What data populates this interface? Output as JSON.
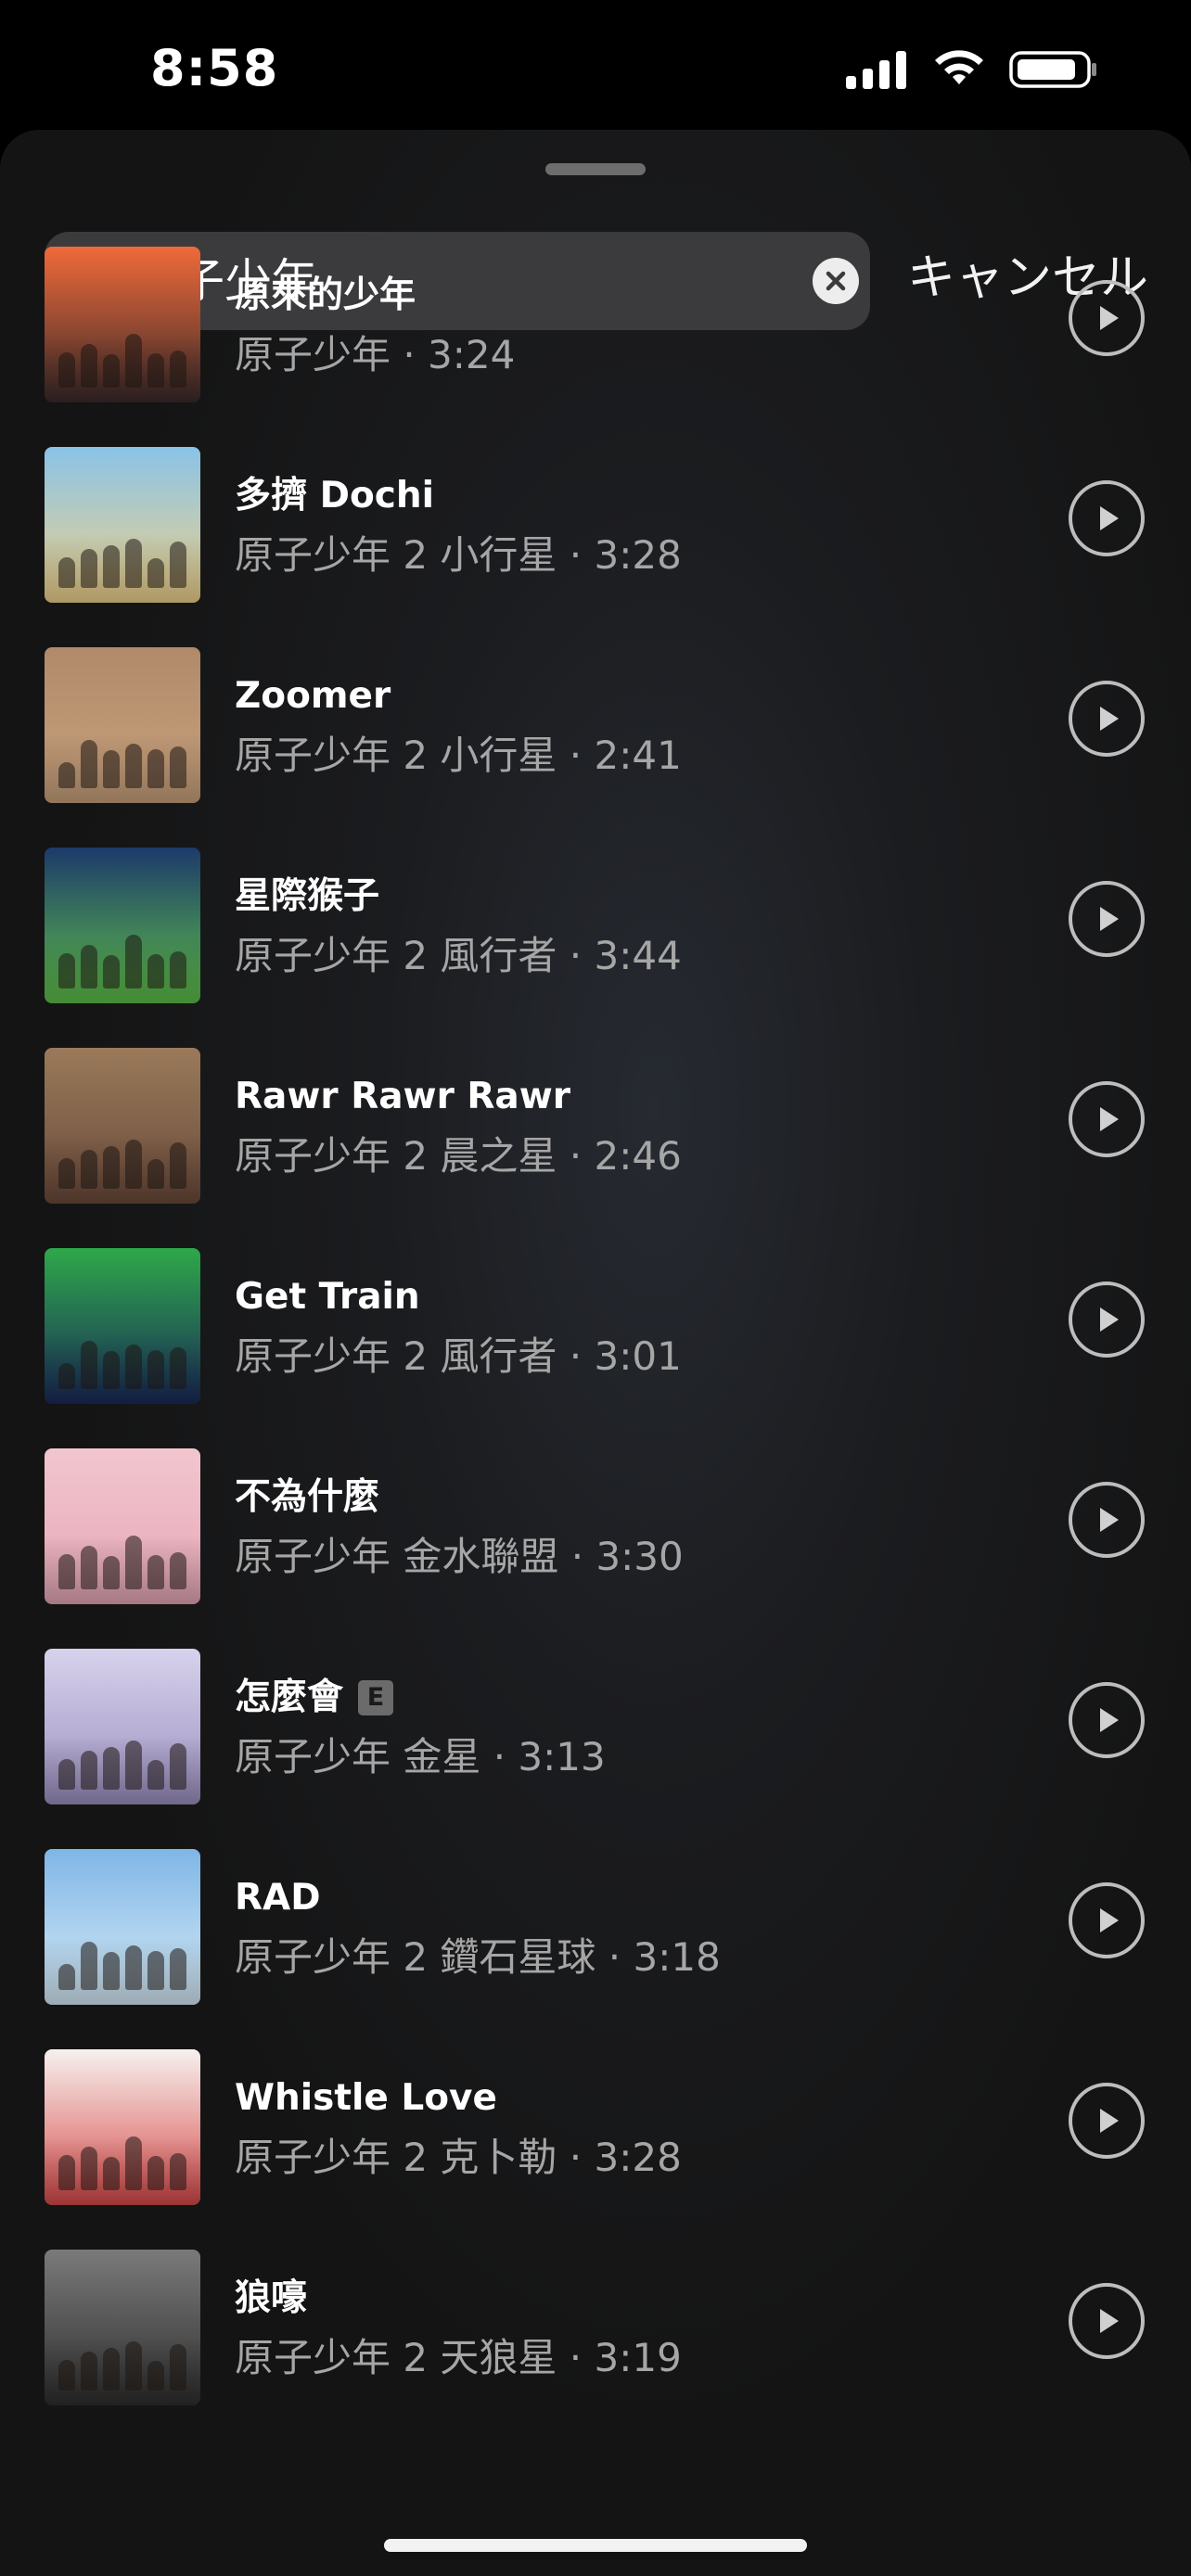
{
  "status_bar": {
    "time": "8:58",
    "icons": [
      "cellular-signal-icon",
      "wifi-icon",
      "battery-icon"
    ]
  },
  "search": {
    "query": "原子少年",
    "cancel_label": "キャンセル",
    "icons": [
      "search-icon",
      "clear-icon"
    ]
  },
  "colors": {
    "background": "#141414",
    "search_field": "#3b3b3d",
    "secondary_text": "#a6a6a6",
    "play_ring": "#bdbdbd"
  },
  "results": [
    {
      "title": "原來的少年",
      "meta": "原子少年 · 3:24",
      "explicit": false,
      "art_top": "#f06a3a",
      "art_bottom": "#3a2a2a"
    },
    {
      "title": "多擠 Dochi",
      "meta": "原子少年 2 小行星 · 3:28",
      "explicit": false,
      "art_top": "#8ac3e8",
      "art_bottom": "#f0d28a"
    },
    {
      "title": "Zoomer",
      "meta": "原子少年 2 小行星 · 2:41",
      "explicit": false,
      "art_top": "#b08a6a",
      "art_bottom": "#c9a27d"
    },
    {
      "title": "星際猴子",
      "meta": "原子少年 2 風行者 · 3:44",
      "explicit": false,
      "art_top": "#1c3a6a",
      "art_bottom": "#5fc04a"
    },
    {
      "title": "Rawr Rawr Rawr",
      "meta": "原子少年 2 晨之星 · 2:46",
      "explicit": false,
      "art_top": "#9a7a5a",
      "art_bottom": "#6a4a3a"
    },
    {
      "title": "Get Train",
      "meta": "原子少年 2 風行者 · 3:01",
      "explicit": false,
      "art_top": "#2ea84a",
      "art_bottom": "#1a2a5a"
    },
    {
      "title": "不為什麼",
      "meta": "原子少年 金水聯盟 · 3:30",
      "explicit": false,
      "art_top": "#f2c6cf",
      "art_bottom": "#e5a7b6"
    },
    {
      "title": "怎麼會",
      "meta": "原子少年 金星 · 3:13",
      "explicit": true,
      "explicit_label": "E",
      "art_top": "#d7d2ec",
      "art_bottom": "#9c90c0"
    },
    {
      "title": "RAD",
      "meta": "原子少年 2 鑽石星球 · 3:18",
      "explicit": false,
      "art_top": "#7fb6e6",
      "art_bottom": "#d8ecf8"
    },
    {
      "title": "Whistle Love",
      "meta": "原子少年 2 克卜勒 · 3:28",
      "explicit": false,
      "art_top": "#f6f1ee",
      "art_bottom": "#d84a4a"
    },
    {
      "title": "狼嚎",
      "meta": "原子少年 2 天狼星 · 3:19",
      "explicit": false,
      "art_top": "#7a7a7a",
      "art_bottom": "#2e2e2e"
    }
  ]
}
